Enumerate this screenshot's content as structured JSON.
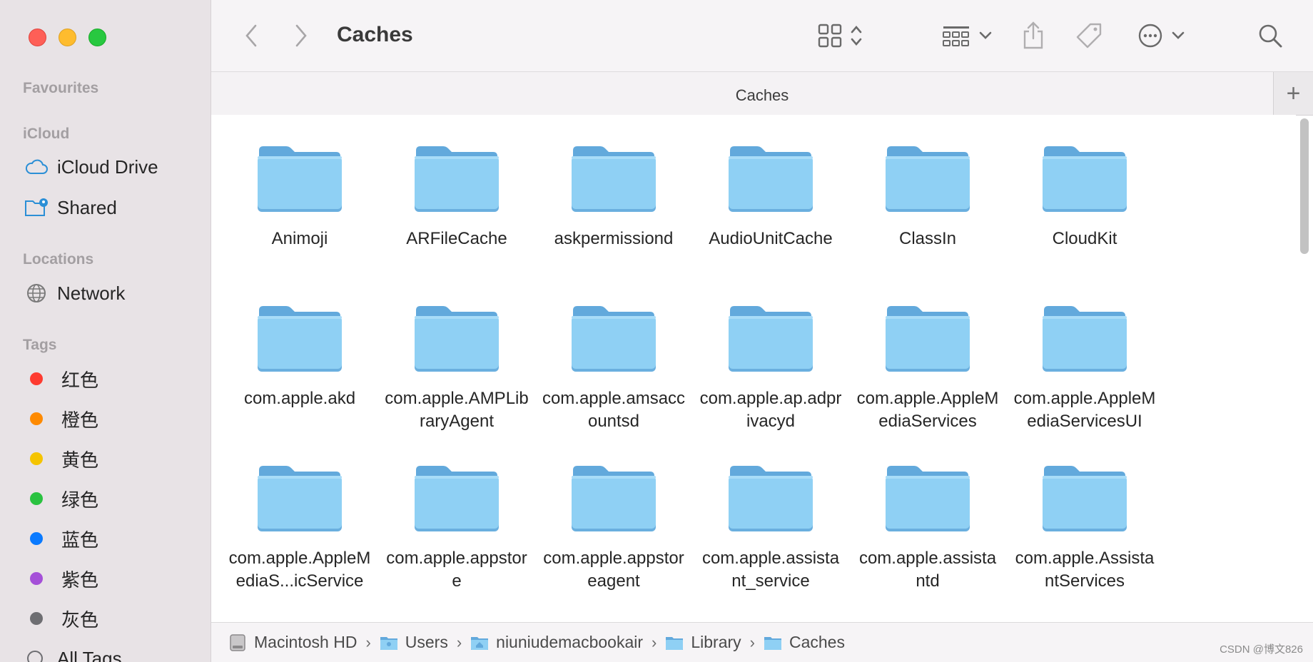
{
  "toolbar": {
    "title": "Caches",
    "back_icon": "chevron-left-icon",
    "forward_icon": "chevron-right-icon"
  },
  "tabbar": {
    "title": "Caches",
    "new_tab_label": "+"
  },
  "sidebar": {
    "favourites_title": "Favourites",
    "icloud_title": "iCloud",
    "icloud_items": [
      {
        "label": "iCloud Drive",
        "icon": "cloud-icon"
      },
      {
        "label": "Shared",
        "icon": "shared-folder-icon"
      }
    ],
    "locations_title": "Locations",
    "location_items": [
      {
        "label": "Network",
        "icon": "globe-icon"
      }
    ],
    "tags_title": "Tags",
    "tags": [
      {
        "label": "红色",
        "color": "#fe3b30"
      },
      {
        "label": "橙色",
        "color": "#fe8a00"
      },
      {
        "label": "黄色",
        "color": "#f5c400"
      },
      {
        "label": "绿色",
        "color": "#2ac240"
      },
      {
        "label": "蓝色",
        "color": "#0a7aff"
      },
      {
        "label": "紫色",
        "color": "#a550d8"
      },
      {
        "label": "灰色",
        "color": "#6e6e72"
      }
    ],
    "all_tags": "All Tags..."
  },
  "folders": [
    "Animoji",
    "ARFileCache",
    "askpermissiond",
    "AudioUnitCache",
    "ClassIn",
    "CloudKit",
    "com.apple.akd",
    "com.apple.AMPLibraryAgent",
    "com.apple.amsaccountsd",
    "com.apple.ap.adprivacyd",
    "com.apple.AppleMediaServices",
    "com.apple.AppleMediaServicesUI",
    "com.apple.AppleMediaS...icService",
    "com.apple.appstore",
    "com.apple.appstoreagent",
    "com.apple.assistant_service",
    "com.apple.assistantd",
    "com.apple.AssistantServices"
  ],
  "pathbar": [
    {
      "label": "Macintosh HD",
      "icon": "disk-icon"
    },
    {
      "label": "Users",
      "icon": "folder-icon"
    },
    {
      "label": "niuniudemacbookair",
      "icon": "home-folder-icon"
    },
    {
      "label": "Library",
      "icon": "folder-icon"
    },
    {
      "label": "Caches",
      "icon": "folder-icon"
    }
  ],
  "watermark": "CSDN @博文826",
  "colors": {
    "folder_body": "#8fd0f4",
    "folder_tab": "#62a9dc",
    "sidebar_bg": "#e8e3e6",
    "accent": "#2b8fd6"
  }
}
